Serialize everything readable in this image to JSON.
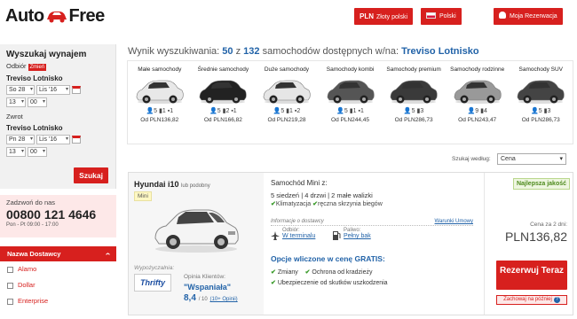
{
  "header": {
    "logo_left": "Auto",
    "logo_right": "Free",
    "currency_code": "PLN",
    "currency_label": "Złoty polski",
    "language": "Polski",
    "account": "Moja Rezerwacja"
  },
  "search": {
    "title": "Wyszukaj wynajem",
    "pickup_label": "Odbiór",
    "change_label": "Zmień",
    "pickup_location": "Treviso Lotnisko",
    "pickup_day": "So 28",
    "pickup_month": "Lis '16",
    "pickup_hour": "13",
    "pickup_min": "00",
    "return_label": "Zwrot",
    "return_location": "Treviso Lotnisko",
    "return_day": "Pn 28",
    "return_month": "Lis '16",
    "return_hour": "13",
    "return_min": "00",
    "search_button": "Szukaj"
  },
  "call": {
    "line1": "Zadzwoń do nas",
    "phone": "00800 121 4646",
    "hours": "Pon - Pt 09:00 - 17:00"
  },
  "suppliers": {
    "header": "Nazwa Dostawcy",
    "items": [
      "Alamo",
      "Dollar",
      "Enterprise"
    ]
  },
  "results": {
    "prefix": "Wynik wyszukiwania:",
    "count": "50",
    "of": "z",
    "total": "132",
    "suffix": "samochodów dostępnych w/na:",
    "location": "Treviso Lotnisko"
  },
  "categories": [
    {
      "name": "Małe samochody",
      "seats": "5",
      "big": "1",
      "small": "1",
      "price": "Od PLN136,82"
    },
    {
      "name": "Średnie samochody",
      "seats": "5",
      "big": "2",
      "small": "1",
      "price": "Od PLN166,82"
    },
    {
      "name": "Duże samochody",
      "seats": "5",
      "big": "1",
      "small": "2",
      "price": "Od PLN219,28"
    },
    {
      "name": "Samochody kombi",
      "seats": "5",
      "big": "1",
      "small": "1",
      "price": "Od PLN244,45"
    },
    {
      "name": "Samochody premium",
      "seats": "5",
      "big": "3",
      "small": "",
      "price": "Od PLN286,73"
    },
    {
      "name": "Samochody rodzinne",
      "seats": "9",
      "big": "4",
      "small": "",
      "price": "Od PLN243,47"
    },
    {
      "name": "Samochody SUV",
      "seats": "5",
      "big": "3",
      "small": "",
      "price": "Od PLN286,73"
    }
  ],
  "sort": {
    "label": "Szukaj według:",
    "value": "Cena"
  },
  "offer": {
    "model": "Hyundai i10",
    "model_sub": "lub podobny",
    "class_badge": "Mini",
    "title": "Samochód Mini z:",
    "seats": "5 siedzeń",
    "doors": "4 drzwi",
    "bags": "2 małe walizki",
    "ac": "Klimatyzacja",
    "gearbox": "ręczna skrzynia biegów",
    "info_label": "Informacje o dostawcy",
    "terms_link": "Warunki Umowy",
    "pickup_lbl": "Odbiór:",
    "pickup_val": "W terminalu",
    "fuel_lbl": "Paliwo:",
    "fuel_val": "Pełny bak",
    "options_title": "Opcje wliczone w cenę GRATIS:",
    "opt1": "Zmiany",
    "opt2": "Ochrona od kradzieży",
    "opt3": "Ubezpieczenie od skutków uszkodzenia",
    "provider_label": "Wypożyczalnia:",
    "provider_logo": "Thrifty",
    "review_label": "Opinia Klientów:",
    "review_word": "\"Wspaniała\"",
    "score": "8,4",
    "score_of": "/ 10",
    "score_count": "(10+ Opinii)",
    "best_badge": "Najlepsza jakość",
    "price_label": "Cena za 2 dni:",
    "price": "PLN136,82",
    "book_button": "Rezerwuj Teraz",
    "later_button": "Zachowaj na później"
  }
}
